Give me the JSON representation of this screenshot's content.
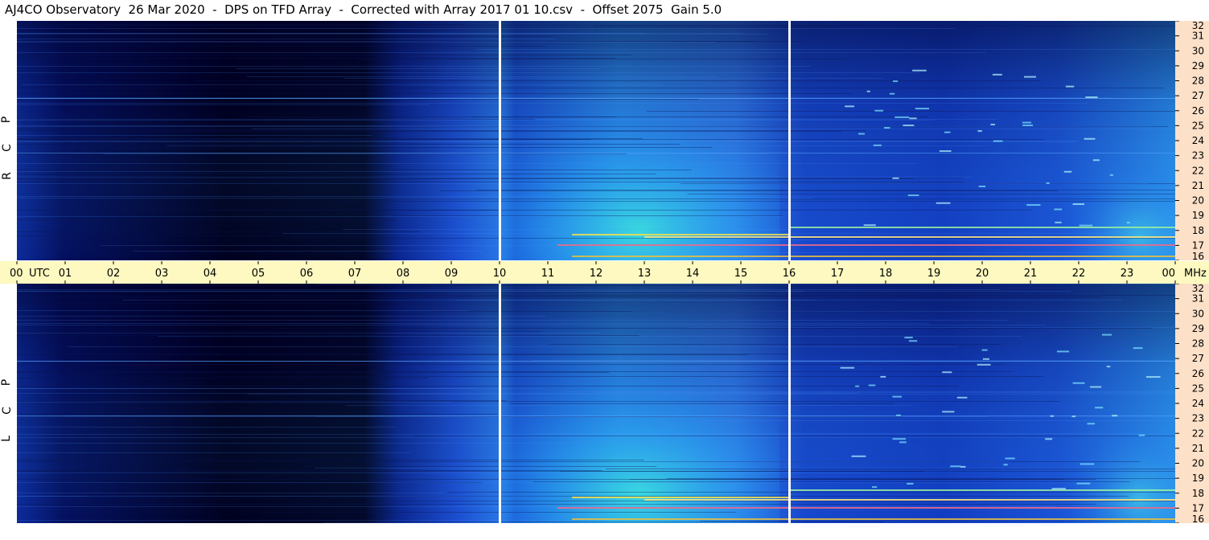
{
  "title": "AJ4CO Observatory  26 Mar 2020  -  DPS on TFD Array  -  Corrected with Array 2017 01 10.csv  -  Offset 2075  Gain 5.0",
  "panels": [
    {
      "id": "top",
      "pol_letters": [
        "R",
        "C",
        "P"
      ]
    },
    {
      "id": "bottom",
      "pol_letters": [
        "L",
        "C",
        "P"
      ]
    }
  ],
  "time_axis": {
    "ticks": [
      "00",
      "01",
      "02",
      "03",
      "04",
      "05",
      "06",
      "07",
      "08",
      "09",
      "10",
      "11",
      "12",
      "13",
      "14",
      "15",
      "16",
      "17",
      "18",
      "19",
      "20",
      "21",
      "22",
      "23",
      "00"
    ],
    "utc_label": "UTC",
    "freq_unit": "MHz"
  },
  "freq_axis": {
    "ticks": [
      "32",
      "31",
      "30",
      "29",
      "28",
      "27",
      "26",
      "25",
      "24",
      "23",
      "22",
      "21",
      "20",
      "19",
      "18",
      "17",
      "16"
    ]
  },
  "colors": {
    "deep": "#0a1a6a",
    "dark": "#000018",
    "mid": "#1a56d8",
    "bright": "#27a8ee",
    "cyan": "#2fd4e0",
    "marker": "#ffffff"
  },
  "chart_data": {
    "type": "heatmap",
    "xlabel": "UTC",
    "ylabel": "MHz",
    "x_range_hours": [
      0,
      24
    ],
    "y_range_mhz": [
      16,
      32
    ],
    "polarizations": [
      "RCP",
      "LCP"
    ],
    "vertical_markers_utc": [
      10,
      16
    ]
  }
}
